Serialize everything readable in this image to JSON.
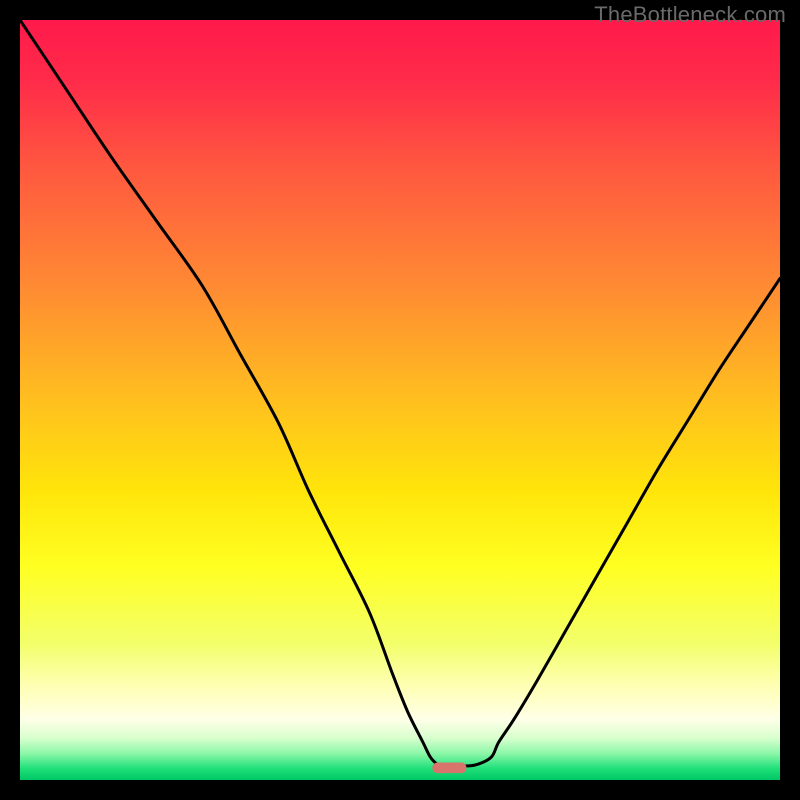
{
  "watermark": "TheBottleneck.com",
  "chart_data": {
    "type": "line",
    "title": "",
    "xlabel": "",
    "ylabel": "",
    "xlim": [
      0,
      100
    ],
    "ylim": [
      0,
      100
    ],
    "curve": {
      "x": [
        0,
        6,
        12,
        18,
        24,
        29,
        34,
        38,
        42,
        46,
        49,
        51,
        53,
        54,
        55,
        56,
        57,
        58,
        60,
        62,
        63,
        65,
        68,
        72,
        76,
        80,
        84,
        88,
        92,
        96,
        100
      ],
      "y": [
        100,
        91,
        82,
        73.5,
        65,
        56,
        47,
        38,
        30,
        22,
        14,
        9,
        5,
        3,
        2,
        1.6,
        1.6,
        1.8,
        2,
        3,
        5,
        8,
        13,
        20,
        27,
        34,
        41,
        47.5,
        54,
        60,
        66
      ]
    },
    "marker": {
      "x": 56.5,
      "y": 1.6,
      "w": 4.5,
      "h": 1.4
    },
    "gradient_stops": [
      {
        "offset": 0.0,
        "color": "#ff1a4b"
      },
      {
        "offset": 0.08,
        "color": "#ff2b4a"
      },
      {
        "offset": 0.2,
        "color": "#ff5a3f"
      },
      {
        "offset": 0.35,
        "color": "#ff8a33"
      },
      {
        "offset": 0.5,
        "color": "#ffbf1f"
      },
      {
        "offset": 0.62,
        "color": "#ffe50a"
      },
      {
        "offset": 0.72,
        "color": "#ffff22"
      },
      {
        "offset": 0.82,
        "color": "#f3ff6a"
      },
      {
        "offset": 0.88,
        "color": "#ffffb8"
      },
      {
        "offset": 0.92,
        "color": "#ffffe8"
      },
      {
        "offset": 0.945,
        "color": "#d8ffce"
      },
      {
        "offset": 0.965,
        "color": "#8cf7a8"
      },
      {
        "offset": 0.985,
        "color": "#1fe07a"
      },
      {
        "offset": 1.0,
        "color": "#00c765"
      }
    ]
  }
}
